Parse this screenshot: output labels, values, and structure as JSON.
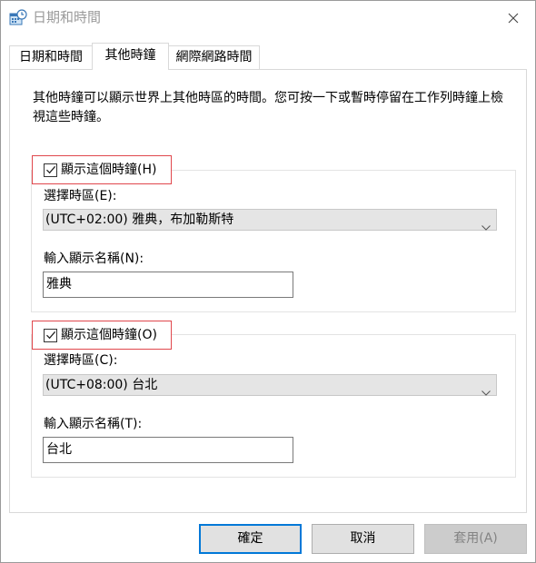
{
  "window": {
    "title": "日期和時間",
    "close_glyph": "✕"
  },
  "tabs": [
    {
      "label": "日期和時間",
      "active": false
    },
    {
      "label": "其他時鐘",
      "active": true
    },
    {
      "label": "網際網路時間",
      "active": false
    }
  ],
  "description": "其他時鐘可以顯示世界上其他時區的時間。您可按一下或暫時停留在工作列時鐘上檢視這些時鐘。",
  "clock1": {
    "checkbox_label": "顯示這個時鐘(H)",
    "checked": true,
    "timezone_label": "選擇時區(E):",
    "timezone_value": "(UTC+02:00) 雅典，布加勒斯特",
    "name_label": "輸入顯示名稱(N):",
    "name_value": "雅典"
  },
  "clock2": {
    "checkbox_label": "顯示這個時鐘(O)",
    "checked": true,
    "timezone_label": "選擇時區(C):",
    "timezone_value": "(UTC+08:00) 台北",
    "name_label": "輸入顯示名稱(T):",
    "name_value": "台北"
  },
  "buttons": {
    "ok": "確定",
    "cancel": "取消",
    "apply": "套用(A)"
  },
  "colors": {
    "highlight_border": "#e0474c",
    "default_button_border": "#0078d7"
  },
  "icons": {
    "app": "clock-calendar-icon",
    "close": "close-icon",
    "check": "checkmark-icon",
    "dropdown": "chevron-down-icon"
  }
}
